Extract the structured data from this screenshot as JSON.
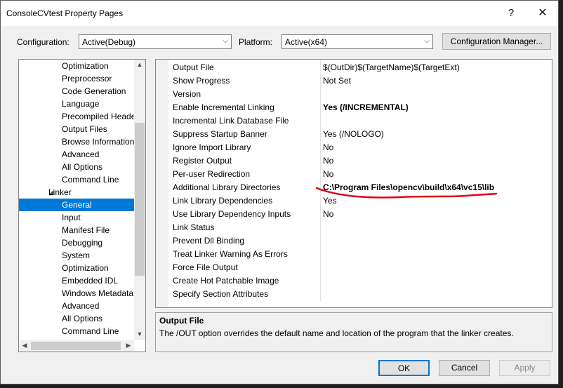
{
  "window": {
    "title": "ConsoleCVtest Property Pages",
    "help_glyph": "?",
    "close_glyph": "✕"
  },
  "toolbar": {
    "configuration_label": "Configuration:",
    "configuration_value": "Active(Debug)",
    "platform_label": "Platform:",
    "platform_value": "Active(x64)",
    "config_manager_label": "Configuration Manager..."
  },
  "tree": {
    "items": [
      {
        "label": "Optimization"
      },
      {
        "label": "Preprocessor"
      },
      {
        "label": "Code Generation"
      },
      {
        "label": "Language"
      },
      {
        "label": "Precompiled Heade"
      },
      {
        "label": "Output Files"
      },
      {
        "label": "Browse Information"
      },
      {
        "label": "Advanced"
      },
      {
        "label": "All Options"
      },
      {
        "label": "Command Line"
      },
      {
        "label": "Linker"
      },
      {
        "label": "General"
      },
      {
        "label": "Input"
      },
      {
        "label": "Manifest File"
      },
      {
        "label": "Debugging"
      },
      {
        "label": "System"
      },
      {
        "label": "Optimization"
      },
      {
        "label": "Embedded IDL"
      },
      {
        "label": "Windows Metadata"
      },
      {
        "label": "Advanced"
      },
      {
        "label": "All Options"
      },
      {
        "label": "Command Line"
      }
    ]
  },
  "properties": [
    {
      "name": "Output File",
      "value": "$(OutDir)$(TargetName)$(TargetExt)"
    },
    {
      "name": "Show Progress",
      "value": "Not Set"
    },
    {
      "name": "Version",
      "value": ""
    },
    {
      "name": "Enable Incremental Linking",
      "value": "Yes (/INCREMENTAL)"
    },
    {
      "name": "Incremental Link Database File",
      "value": ""
    },
    {
      "name": "Suppress Startup Banner",
      "value": "Yes (/NOLOGO)"
    },
    {
      "name": "Ignore Import Library",
      "value": "No"
    },
    {
      "name": "Register Output",
      "value": "No"
    },
    {
      "name": "Per-user Redirection",
      "value": "No"
    },
    {
      "name": "Additional Library Directories",
      "value": "C:\\Program Files\\opencv\\build\\x64\\vc15\\lib"
    },
    {
      "name": "Link Library Dependencies",
      "value": "Yes"
    },
    {
      "name": "Use Library Dependency Inputs",
      "value": "No"
    },
    {
      "name": "Link Status",
      "value": ""
    },
    {
      "name": "Prevent Dll Binding",
      "value": ""
    },
    {
      "name": "Treat Linker Warning As Errors",
      "value": ""
    },
    {
      "name": "Force File Output",
      "value": ""
    },
    {
      "name": "Create Hot Patchable Image",
      "value": ""
    },
    {
      "name": "Specify Section Attributes",
      "value": ""
    }
  ],
  "description": {
    "title": "Output File",
    "text": "The /OUT option overrides the default name and location of the program that the linker creates."
  },
  "buttons": {
    "ok": "OK",
    "cancel": "Cancel",
    "apply": "Apply"
  },
  "colors": {
    "selection": "#0078d7",
    "annotation": "#e0001b"
  }
}
